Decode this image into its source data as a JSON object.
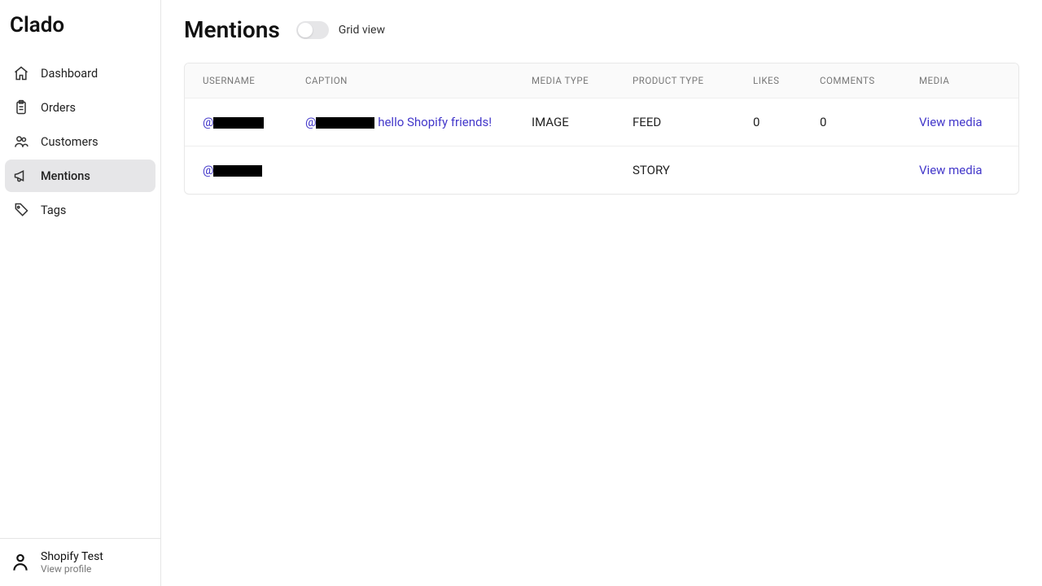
{
  "brand": "Clado",
  "sidebar": {
    "items": [
      {
        "label": "Dashboard"
      },
      {
        "label": "Orders"
      },
      {
        "label": "Customers"
      },
      {
        "label": "Mentions"
      },
      {
        "label": "Tags"
      }
    ]
  },
  "footer": {
    "name": "Shopify Test",
    "sub": "View profile"
  },
  "header": {
    "title": "Mentions",
    "toggle_label": "Grid view"
  },
  "table": {
    "columns": {
      "username": "USERNAME",
      "caption": "CAPTION",
      "media_type": "MEDIA TYPE",
      "product_type": "PRODUCT TYPE",
      "likes": "LIKES",
      "comments": "COMMENTS",
      "media": "MEDIA"
    },
    "rows": [
      {
        "username_prefix": "@",
        "caption_prefix": "@",
        "caption_suffix": " hello Shopify friends!",
        "media_type": "IMAGE",
        "product_type": "FEED",
        "likes": "0",
        "comments": "0",
        "media_action": "View media"
      },
      {
        "username_prefix": "@",
        "caption_prefix": "",
        "caption_suffix": "",
        "media_type": "",
        "product_type": "STORY",
        "likes": "",
        "comments": "",
        "media_action": "View media"
      }
    ]
  }
}
